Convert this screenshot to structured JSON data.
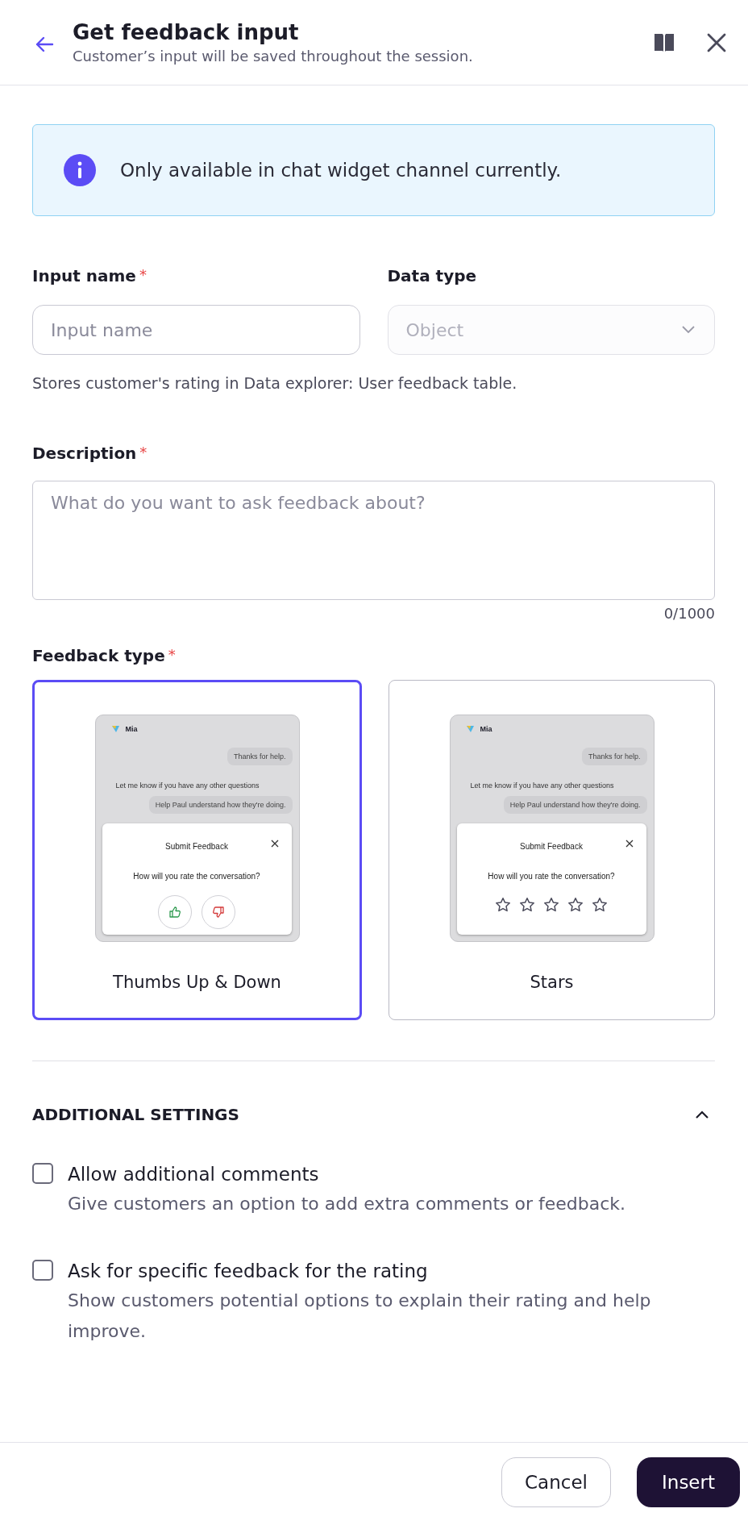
{
  "header": {
    "title": "Get feedback input",
    "subtitle": "Customer’s input will be saved throughout the session."
  },
  "info": {
    "message": "Only available in chat widget channel currently."
  },
  "fields": [
    {
      "kind": "text",
      "label": "Input name",
      "required_mark": "*",
      "placeholder": "Input name"
    },
    {
      "kind": "select",
      "label": "Data type",
      "value": "Object",
      "disabled": true
    }
  ],
  "fields_hint": "Stores customer's rating in Data explorer: User feedback table.",
  "description": {
    "label": "Description",
    "required_mark": "*",
    "placeholder": "What do you want to ask feedback about?",
    "counter": "0/1000"
  },
  "feedback_type": {
    "label": "Feedback type",
    "required_mark": "*",
    "options": [
      {
        "kind": "thumbs",
        "label": "Thumbs Up & Down",
        "selected": true,
        "preview": {
          "agent": "Mia",
          "user_message": "Thanks for help.",
          "agent_message": "Let me know if you have any other questions",
          "bubble": "Help Paul understand how they're doing.",
          "popup_title": "Submit Feedback",
          "question": "How will you rate the conversation?"
        }
      },
      {
        "kind": "stars",
        "label": "Stars",
        "selected": false,
        "preview": {
          "agent": "Mia",
          "user_message": "Thanks for help.",
          "agent_message": "Let me know if you have any other questions",
          "bubble": "Help Paul understand how they're doing.",
          "popup_title": "Submit Feedback",
          "question": "How will you rate the conversation?",
          "stars": 0
        }
      }
    ]
  },
  "additional_settings": {
    "title": "ADDITIONAL SETTINGS",
    "expanded": true,
    "items": [
      {
        "label": "Allow additional comments",
        "description": "Give customers an option to add extra comments or feedback.",
        "checked": false
      },
      {
        "label": "Ask for specific feedback for the rating",
        "description": "Show customers potential options to explain their rating and help improve.",
        "checked": false
      }
    ]
  },
  "footer": {
    "buttons": [
      {
        "kind": "secondary",
        "label": "Cancel"
      },
      {
        "kind": "primary",
        "label": "Insert"
      }
    ]
  }
}
